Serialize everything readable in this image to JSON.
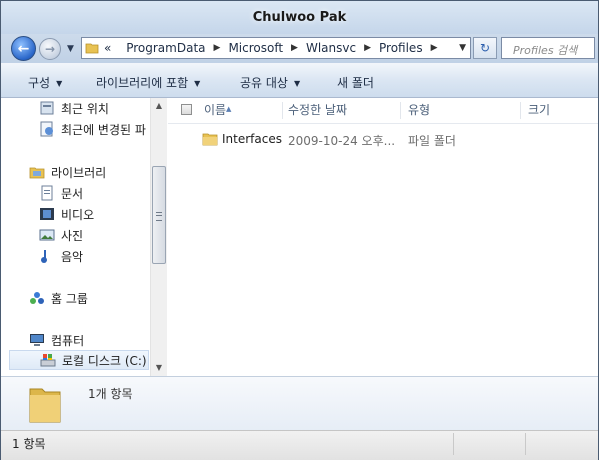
{
  "window": {
    "title": "Chulwoo Pak"
  },
  "address_bar": {
    "chevron": "«",
    "crumbs": [
      "ProgramData",
      "Microsoft",
      "Wlansvc",
      "Profiles"
    ]
  },
  "search": {
    "placeholder": "Profiles 검색"
  },
  "toolbar": {
    "organize": "구성",
    "include_in_library": "라이브러리에 포함",
    "share_with": "공유 대상",
    "new_folder": "새 폴더"
  },
  "nav_pane": {
    "recent_places": "최근 위치",
    "recently_changed": "최근에 변경된 파",
    "libraries": "라이브러리",
    "documents": "문서",
    "videos": "비디오",
    "pictures": "사진",
    "music": "음악",
    "homegroup": "홈 그룹",
    "computer": "컴퓨터",
    "local_disk": "로컬 디스크 (C:)"
  },
  "columns": {
    "name": "이름",
    "date_modified": "수정한 날짜",
    "type": "유형",
    "size": "크기"
  },
  "files": [
    {
      "name": "Interfaces",
      "date": "2009-10-24 오후...",
      "type": "파일 폴더",
      "size": ""
    }
  ],
  "details_pane": {
    "item_count": "1개 항목"
  },
  "status_bar": {
    "text": "1 항목"
  },
  "colors": {
    "accent": "#2a66c9",
    "folder": "#e8c253",
    "chrome": "#cfdcec"
  }
}
